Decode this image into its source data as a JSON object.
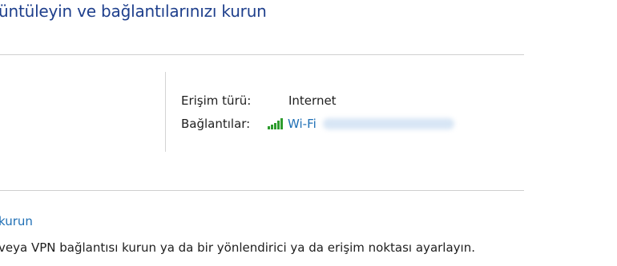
{
  "header": {
    "title": "üntüleyin ve bağlantılarınızı kurun"
  },
  "network": {
    "access_type_label": "Erişim türü:",
    "access_type_value": "Internet",
    "connections_label": "Bağlantılar:",
    "connection_name": "Wi-Fi",
    "connection_icon": "wifi-signal-bars-icon",
    "signal_color": "#2e9c2e"
  },
  "setup": {
    "link": "kurun",
    "description": "veya VPN bağlantısı kurun ya da bir yönlendirici ya da erişim noktası ayarlayın."
  },
  "colors": {
    "title": "#1e3f8c",
    "link": "#1f6fb5"
  }
}
